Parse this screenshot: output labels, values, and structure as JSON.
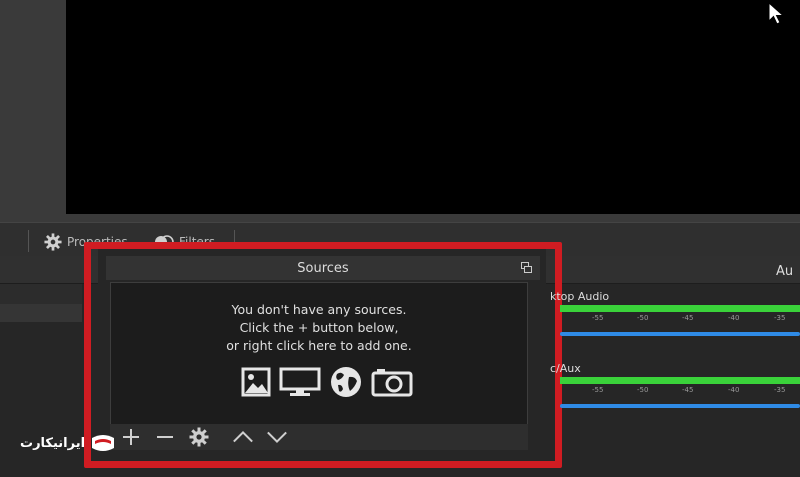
{
  "toolbar": {
    "properties_label": "Properties",
    "filters_label": "Filters"
  },
  "sources": {
    "title": "Sources",
    "empty_lines": [
      "You don't have any sources.",
      "Click the + button below,",
      "or right click here to add one."
    ],
    "source_type_icons": [
      "image-icon",
      "display-icon",
      "browser-globe-icon",
      "camera-icon"
    ],
    "footer_buttons": [
      "add-icon",
      "remove-icon",
      "gear-icon",
      "move-up-icon",
      "move-down-icon"
    ]
  },
  "audio": {
    "title": "Au",
    "channels": [
      {
        "label": "ktop Audio",
        "scale": [
          "-55",
          "-50",
          "-45",
          "-40",
          "-35"
        ]
      },
      {
        "label": "c/Aux",
        "scale": [
          "-55",
          "-50",
          "-45",
          "-40",
          "-35"
        ]
      }
    ]
  },
  "watermark": {
    "text": "ایرانیکارت"
  },
  "colors": {
    "highlight": "#d01c22",
    "meter_green": "#3ad23a",
    "volume_blue": "#2f8be6"
  }
}
